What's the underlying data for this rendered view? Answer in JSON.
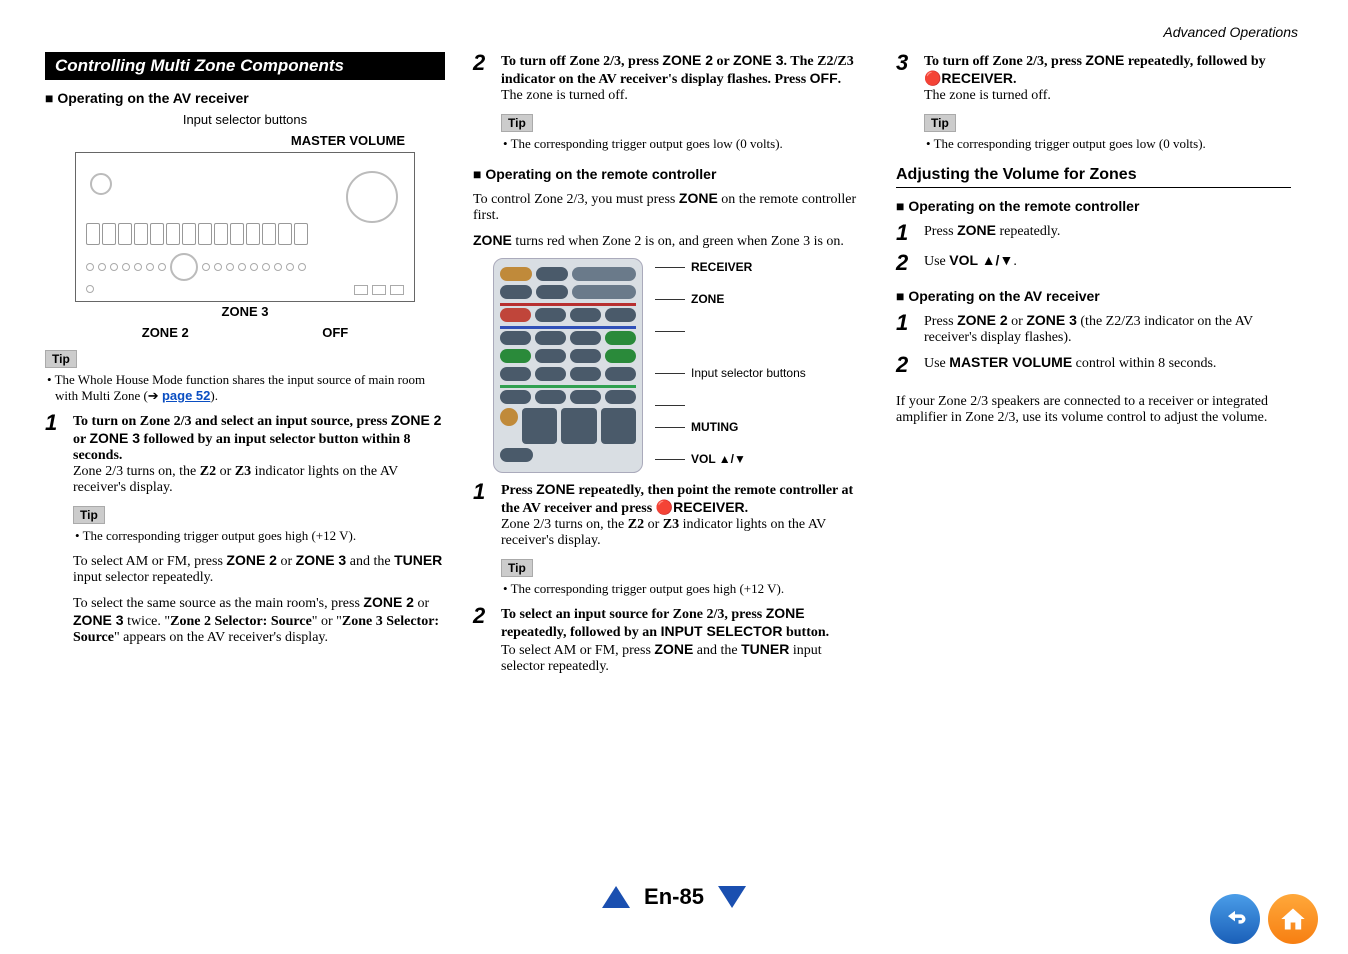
{
  "header": {
    "section": "Advanced Operations"
  },
  "col1": {
    "title": "Controlling Multi Zone Components",
    "sub1": "Operating on the AV receiver",
    "cap_input": "Input selector buttons",
    "cap_master": "MASTER VOLUME",
    "label_zone3": "ZONE 3",
    "label_zone2": "ZONE 2",
    "label_off": "OFF",
    "tip1_label": "Tip",
    "tip1_text_a": "The Whole House Mode function shares the input source of main room with Multi Zone (➔ ",
    "tip1_link": "page 52",
    "tip1_text_b": ").",
    "step1_num": "1",
    "step1_lead_a": "To turn on Zone 2/3 and select an input source, press ",
    "step1_lead_b": "ZONE 2",
    "step1_lead_c": " or ",
    "step1_lead_d": "ZONE 3",
    "step1_lead_e": " followed by an input selector button within 8 seconds.",
    "step1_body_a": "Zone 2/3 turns on, the ",
    "step1_body_b": "Z2",
    "step1_body_c": " or ",
    "step1_body_d": "Z3",
    "step1_body_e": " indicator lights on the AV receiver's display.",
    "tip2_label": "Tip",
    "tip2_text": "The corresponding trigger output goes high (+12 V).",
    "p_amfm_a": "To select AM or FM, press ",
    "p_amfm_b": "ZONE 2",
    "p_amfm_c": " or ",
    "p_amfm_d": "ZONE 3",
    "p_amfm_e": " and the ",
    "p_amfm_f": "TUNER",
    "p_amfm_g": " input selector repeatedly.",
    "p_same_a": "To select the same source as the main room's, press ",
    "p_same_b": "ZONE 2",
    "p_same_c": " or ",
    "p_same_d": "ZONE 3",
    "p_same_e": " twice. \"",
    "p_same_f": "Zone 2 Selector: Source",
    "p_same_g": "\" or \"",
    "p_same_h": "Zone 3 Selector: Source",
    "p_same_i": "\" appears on the AV receiver's display."
  },
  "col2": {
    "step2_num": "2",
    "step2_lead_a": "To turn off Zone 2/3, press ",
    "step2_lead_b": "ZONE 2",
    "step2_lead_c": " or ",
    "step2_lead_d": "ZONE 3",
    "step2_lead_e": ". The Z2/Z3 indicator on the AV receiver's display flashes. Press ",
    "step2_lead_f": "OFF",
    "step2_lead_g": ".",
    "step2_body": "The zone is turned off.",
    "tip_lbl": "Tip",
    "tip_txt": "The corresponding trigger output goes low (0 volts).",
    "sub_remote": "Operating on the remote controller",
    "intro_a": "To control Zone 2/3, you must press ",
    "intro_b": "ZONE",
    "intro_c": " on the remote controller first.",
    "intro2_a": "ZONE",
    "intro2_b": " turns red when Zone 2 is on, and green when Zone 3 is on.",
    "remote_labels": {
      "receiver": "RECEIVER",
      "zone": "ZONE",
      "input": "Input selector buttons",
      "muting": "MUTING",
      "vol": "VOL ▲/▼"
    },
    "r_step1_num": "1",
    "r_step1_lead_a": "Press ",
    "r_step1_lead_b": "ZONE",
    "r_step1_lead_c": " repeatedly, then point the remote controller at the AV receiver and press ",
    "r_step1_lead_d": "RECEIVER",
    "r_step1_lead_e": ".",
    "r_step1_body_a": "Zone 2/3 turns on, the ",
    "r_step1_body_b": "Z2",
    "r_step1_body_c": " or ",
    "r_step1_body_d": "Z3",
    "r_step1_body_e": " indicator lights on the AV receiver's display.",
    "r_tip_lbl": "Tip",
    "r_tip_txt": "The corresponding trigger output goes high (+12 V).",
    "r_step2_num": "2",
    "r_step2_lead_a": "To select an input source for Zone 2/3, press ",
    "r_step2_lead_b": "ZONE",
    "r_step2_lead_c": " repeatedly, followed by an ",
    "r_step2_lead_d": "INPUT SELECTOR",
    "r_step2_lead_e": " button.",
    "r_step2_body_a": "To select AM or FM, press ",
    "r_step2_body_b": "ZONE",
    "r_step2_body_c": " and the ",
    "r_step2_body_d": "TUNER",
    "r_step2_body_e": " input selector repeatedly."
  },
  "col3": {
    "step3_num": "3",
    "step3_lead_a": "To turn off Zone 2/3, press ",
    "step3_lead_b": "ZONE",
    "step3_lead_c": " repeatedly, followed by ",
    "step3_lead_d": "🔴RECEIVER",
    "step3_lead_e": ".",
    "step3_body": "The zone is turned off.",
    "tip_lbl": "Tip",
    "tip_txt": "The corresponding trigger output goes low (0 volts).",
    "sec_h": "Adjusting the Volume for Zones",
    "sub_remote": "Operating on the remote controller",
    "s1_num": "1",
    "s1_a": "Press ",
    "s1_b": "ZONE",
    "s1_c": " repeatedly.",
    "s2_num": "2",
    "s2_a": "Use ",
    "s2_b": "VOL ▲/▼",
    "s2_c": ".",
    "sub_av": "Operating on the AV receiver",
    "a1_num": "1",
    "a1_a": "Press ",
    "a1_b": "ZONE 2",
    "a1_c": " or ",
    "a1_d": "ZONE 3",
    "a1_e": " (the Z2/Z3 indicator on the AV receiver's display flashes).",
    "a2_num": "2",
    "a2_a": "Use ",
    "a2_b": "MASTER VOLUME",
    "a2_c": " control within 8 seconds.",
    "closing": "If your Zone 2/3 speakers are connected to a receiver or integrated amplifier in Zone 2/3, use its volume control to adjust the volume."
  },
  "footer": {
    "page": "En-85"
  }
}
